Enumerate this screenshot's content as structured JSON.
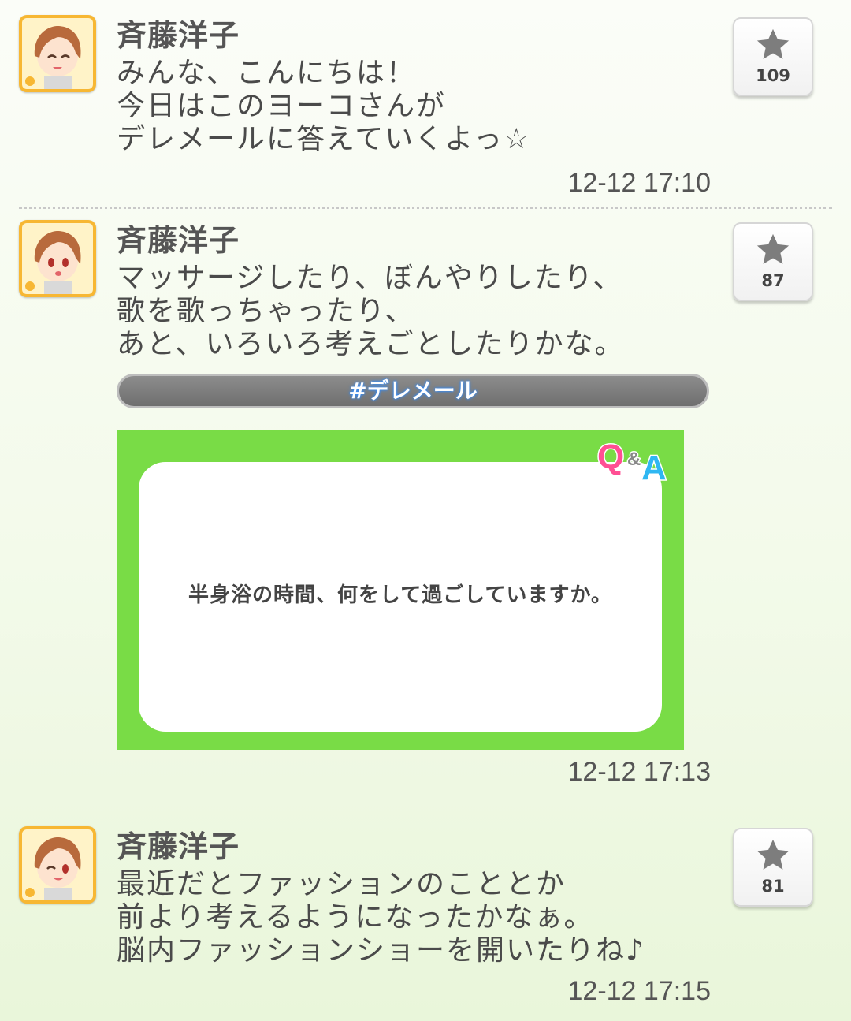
{
  "posts": [
    {
      "author": "斉藤洋子",
      "lines": [
        "みんな、こんにちは！",
        "今日はこのヨーコさんが",
        "デレメールに答えていくよっ☆"
      ],
      "timestamp": "12-12 17:10",
      "star_count": "109"
    },
    {
      "author": "斉藤洋子",
      "lines": [
        "マッサージしたり、ぼんやりしたり、",
        "歌を歌っちゃったり、",
        "あと、いろいろ考えごとしたりかな。"
      ],
      "hashtag": "#デレメール",
      "card": {
        "badge_q": "Q",
        "badge_amp": "&",
        "badge_a": "A",
        "question": "半身浴の時間、何をして過ごしていますか。"
      },
      "timestamp": "12-12 17:13",
      "star_count": "87"
    },
    {
      "author": "斉藤洋子",
      "lines": [
        "最近だとファッションのこととか",
        "前より考えるようになったかなぁ。",
        "脳内ファッションショーを開いたりね♪"
      ],
      "timestamp": "12-12 17:15",
      "star_count": "81"
    }
  ],
  "colors": {
    "card_green": "#79dc46",
    "avatar_frame": "#f7b733",
    "hashtag_glow": "#2f8cff"
  },
  "icons": {
    "star": "star-icon",
    "avatar": "avatar"
  }
}
